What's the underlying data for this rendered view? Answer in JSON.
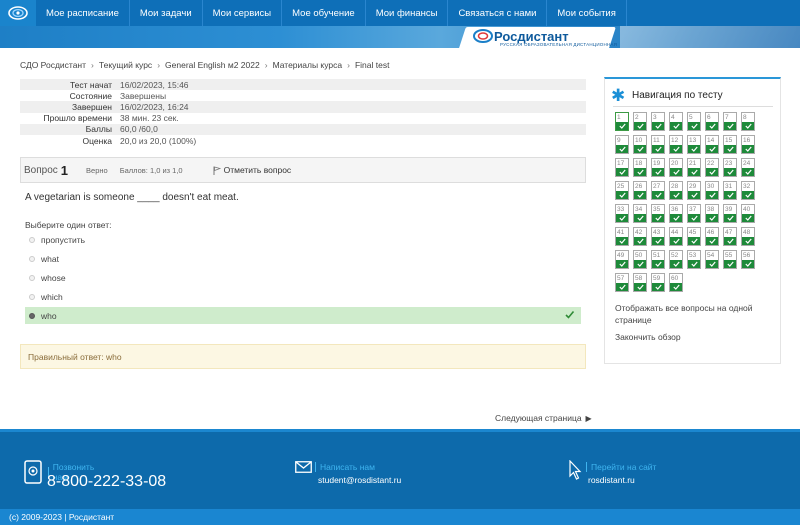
{
  "nav": {
    "items": [
      "Мое расписание",
      "Мои задачи",
      "Мои сервисы",
      "Мое обучение",
      "Мои финансы",
      "Связаться с нами",
      "Мои события"
    ]
  },
  "banner": {
    "brand": "Росдистант",
    "subtitle": "РУССКАЯ ОБРАЗОВАТЕЛЬНАЯ ДИСТАНЦИОННАЯ"
  },
  "breadcrumb": [
    "СДО Росдистант",
    "Текущий курс",
    "General English м2 2022",
    "Материалы курса",
    "Final test"
  ],
  "summary": [
    {
      "label": "Тест начат",
      "value": "16/02/2023, 15:46"
    },
    {
      "label": "Состояние",
      "value": "Завершены"
    },
    {
      "label": "Завершен",
      "value": "16/02/2023, 16:24"
    },
    {
      "label": "Прошло времени",
      "value": "38 мин. 23 сек."
    },
    {
      "label": "Баллы",
      "value": "60,0 /60,0"
    },
    {
      "label": "Оценка",
      "value": "20,0 из 20,0 (100%)"
    }
  ],
  "question": {
    "word": "Вопрос",
    "number": "1",
    "state": "Верно",
    "grade": "Баллов: 1,0 из 1,0",
    "flag_label": "Отметить вопрос",
    "text": "A vegetarian is someone ____ doesn't eat meat.",
    "prompt": "Выберите один ответ:",
    "answers": [
      {
        "label": "пропустить",
        "selected": false
      },
      {
        "label": "what",
        "selected": false
      },
      {
        "label": "whose",
        "selected": false
      },
      {
        "label": "which",
        "selected": false
      },
      {
        "label": "who",
        "selected": true
      }
    ],
    "right_answer": "Правильный ответ: who"
  },
  "quiz_nav": {
    "title": "Навигация по тесту",
    "total": 60,
    "current": 1,
    "show_all_label": "Отображать все вопросы на одной странице",
    "finish_label": "Закончить обзор"
  },
  "next_page": "Следующая страница",
  "footer": {
    "phone_title": "Позвонить нам",
    "phone": "8-800-222-33-08",
    "mail_title": "Написать нам",
    "mail": "student@rosdistant.ru",
    "site_title": "Перейти на сайт",
    "site": "rosdistant.ru",
    "copyright": "(c) 2009-2023 | Росдистант"
  },
  "colors": {
    "nav_bg": "#0e6fb8",
    "correct_bg": "#cfeccc",
    "grid_green": "#1e8a3a",
    "footer_bg": "#0d6aab",
    "accent": "#3fb5f0"
  }
}
